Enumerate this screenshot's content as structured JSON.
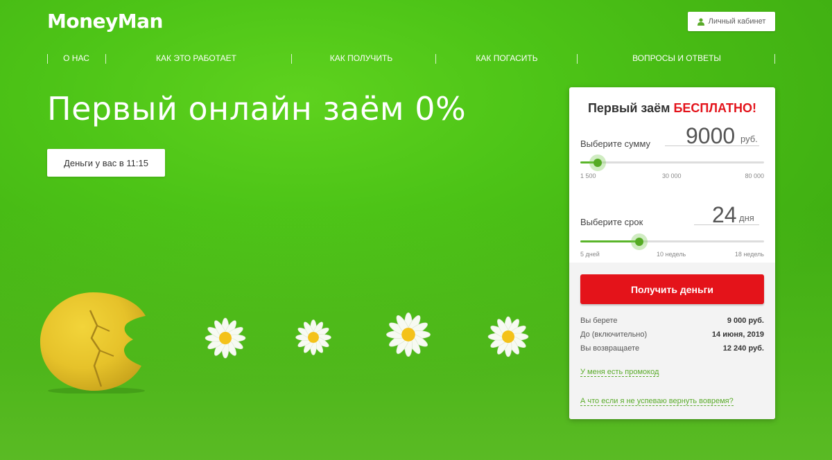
{
  "header": {
    "logo": "MoneyMan",
    "cabinet_label": "Личный кабинет"
  },
  "nav": {
    "items": [
      {
        "label": "О НАС"
      },
      {
        "label": "КАК ЭТО РАБОТАЕТ"
      },
      {
        "label": "КАК ПОЛУЧИТЬ"
      },
      {
        "label": "КАК ПОГАСИТЬ"
      },
      {
        "label": "ВОПРОСЫ И ОТВЕТЫ"
      }
    ]
  },
  "hero": {
    "headline": "Первый онлайн заём 0%",
    "money_time": "Деньги у вас в 11:15"
  },
  "calculator": {
    "title_prefix": "Первый заём ",
    "title_highlight": "БЕСПЛАТНО!",
    "amount": {
      "label": "Выберите сумму",
      "value": "9000",
      "unit": "руб.",
      "ticks": [
        "1 500",
        "30 000",
        "80 000"
      ],
      "slider_position": 0.094
    },
    "term": {
      "label": "Выберите срок",
      "value": "24",
      "unit": "дня",
      "ticks": [
        "5 дней",
        "10 недель",
        "18 недель"
      ],
      "slider_position": 0.322
    },
    "submit_label": "Получить деньги",
    "summary": [
      {
        "label": "Вы берете",
        "value": "9 000 руб."
      },
      {
        "label": "До (включительно)",
        "value": "14 июня, 2019"
      },
      {
        "label": "Вы возвращаете",
        "value": "12 240 руб."
      }
    ],
    "promo_link": "У меня есть промокод",
    "late_link": "А что если я не успеваю вернуть вовремя?"
  },
  "colors": {
    "brand_green": "#4dc417",
    "accent_red": "#e4131a",
    "slider_green": "#55ab24"
  },
  "icons": {
    "cabinet": "user-icon"
  }
}
